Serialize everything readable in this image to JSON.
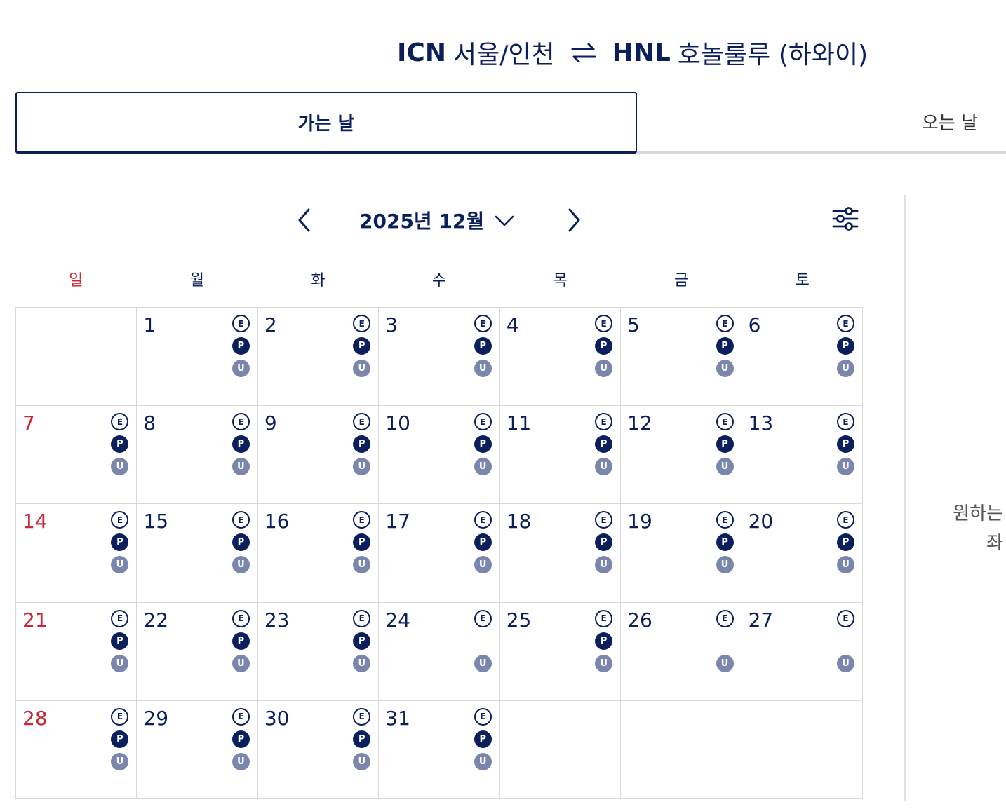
{
  "route": {
    "origin_code": "ICN",
    "origin_name": "서울/인천",
    "destination_code": "HNL",
    "destination_name": "호놀룰루 (하와이)",
    "swap_icon": "swap-arrows-icon"
  },
  "tabs": {
    "outbound": "가는 날",
    "return": "오는 날"
  },
  "calendar": {
    "month_label": "2025년 12월",
    "weekdays": [
      "일",
      "월",
      "화",
      "수",
      "목",
      "금",
      "토"
    ],
    "first_weekday_index": 1,
    "fare_badge_letters": {
      "e": "E",
      "p": "P",
      "u": "U"
    },
    "days": [
      {
        "d": "1",
        "e": true,
        "p": true,
        "u": true
      },
      {
        "d": "2",
        "e": true,
        "p": true,
        "u": true
      },
      {
        "d": "3",
        "e": true,
        "p": true,
        "u": true
      },
      {
        "d": "4",
        "e": true,
        "p": true,
        "u": true
      },
      {
        "d": "5",
        "e": true,
        "p": true,
        "u": true
      },
      {
        "d": "6",
        "e": true,
        "p": true,
        "u": true
      },
      {
        "d": "7",
        "e": true,
        "p": true,
        "u": true
      },
      {
        "d": "8",
        "e": true,
        "p": true,
        "u": true
      },
      {
        "d": "9",
        "e": true,
        "p": true,
        "u": true
      },
      {
        "d": "10",
        "e": true,
        "p": true,
        "u": true
      },
      {
        "d": "11",
        "e": true,
        "p": true,
        "u": true
      },
      {
        "d": "12",
        "e": true,
        "p": true,
        "u": true
      },
      {
        "d": "13",
        "e": true,
        "p": true,
        "u": true
      },
      {
        "d": "14",
        "e": true,
        "p": true,
        "u": true
      },
      {
        "d": "15",
        "e": true,
        "p": true,
        "u": true
      },
      {
        "d": "16",
        "e": true,
        "p": true,
        "u": true
      },
      {
        "d": "17",
        "e": true,
        "p": true,
        "u": true
      },
      {
        "d": "18",
        "e": true,
        "p": true,
        "u": true
      },
      {
        "d": "19",
        "e": true,
        "p": true,
        "u": true
      },
      {
        "d": "20",
        "e": true,
        "p": true,
        "u": true
      },
      {
        "d": "21",
        "e": true,
        "p": true,
        "u": true
      },
      {
        "d": "22",
        "e": true,
        "p": true,
        "u": true
      },
      {
        "d": "23",
        "e": true,
        "p": true,
        "u": true
      },
      {
        "d": "24",
        "e": true,
        "p": false,
        "u": true
      },
      {
        "d": "25",
        "e": true,
        "p": true,
        "u": true
      },
      {
        "d": "26",
        "e": true,
        "p": false,
        "u": true
      },
      {
        "d": "27",
        "e": true,
        "p": false,
        "u": true
      },
      {
        "d": "28",
        "e": true,
        "p": true,
        "u": true
      },
      {
        "d": "29",
        "e": true,
        "p": true,
        "u": true
      },
      {
        "d": "30",
        "e": true,
        "p": true,
        "u": true
      },
      {
        "d": "31",
        "e": true,
        "p": true,
        "u": true
      }
    ]
  },
  "side_panel": {
    "line1": "원하는",
    "line2": "좌"
  },
  "colors": {
    "navy": "#0b1f5c",
    "sunday_red": "#c8283a",
    "badge_u": "#7b86ad",
    "grid_line": "#d9d9d9"
  },
  "icons": {
    "prev": "chevron-left-icon",
    "next": "chevron-right-icon",
    "month_dropdown": "chevron-down-icon",
    "filter": "filter-sliders-icon"
  }
}
